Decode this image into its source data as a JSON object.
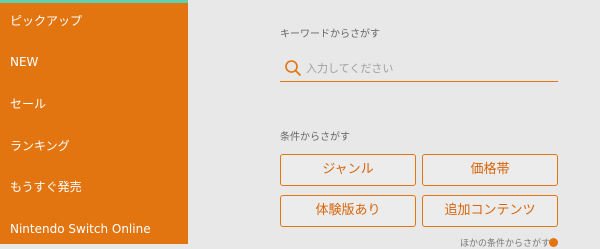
{
  "sidebar": {
    "items": [
      {
        "label": "ピックアップ"
      },
      {
        "label": "NEW"
      },
      {
        "label": "セール"
      },
      {
        "label": "ランキング"
      },
      {
        "label": "もうすぐ発売"
      },
      {
        "label": "Nintendo Switch Online"
      }
    ]
  },
  "keyword_search": {
    "label": "キーワードからさがす",
    "placeholder": "入力してください",
    "value": ""
  },
  "condition_search": {
    "label": "条件からさがす",
    "buttons": [
      {
        "label": "ジャンル"
      },
      {
        "label": "価格帯"
      },
      {
        "label": "体験版あり"
      },
      {
        "label": "追加コンテンツ"
      }
    ],
    "more_label": "ほかの条件からさがす"
  },
  "colors": {
    "accent": "#e27510",
    "sidebar_top_line": "#5fd0b0",
    "background": "#e8e8e8"
  },
  "icons": {
    "search": "search-icon"
  }
}
